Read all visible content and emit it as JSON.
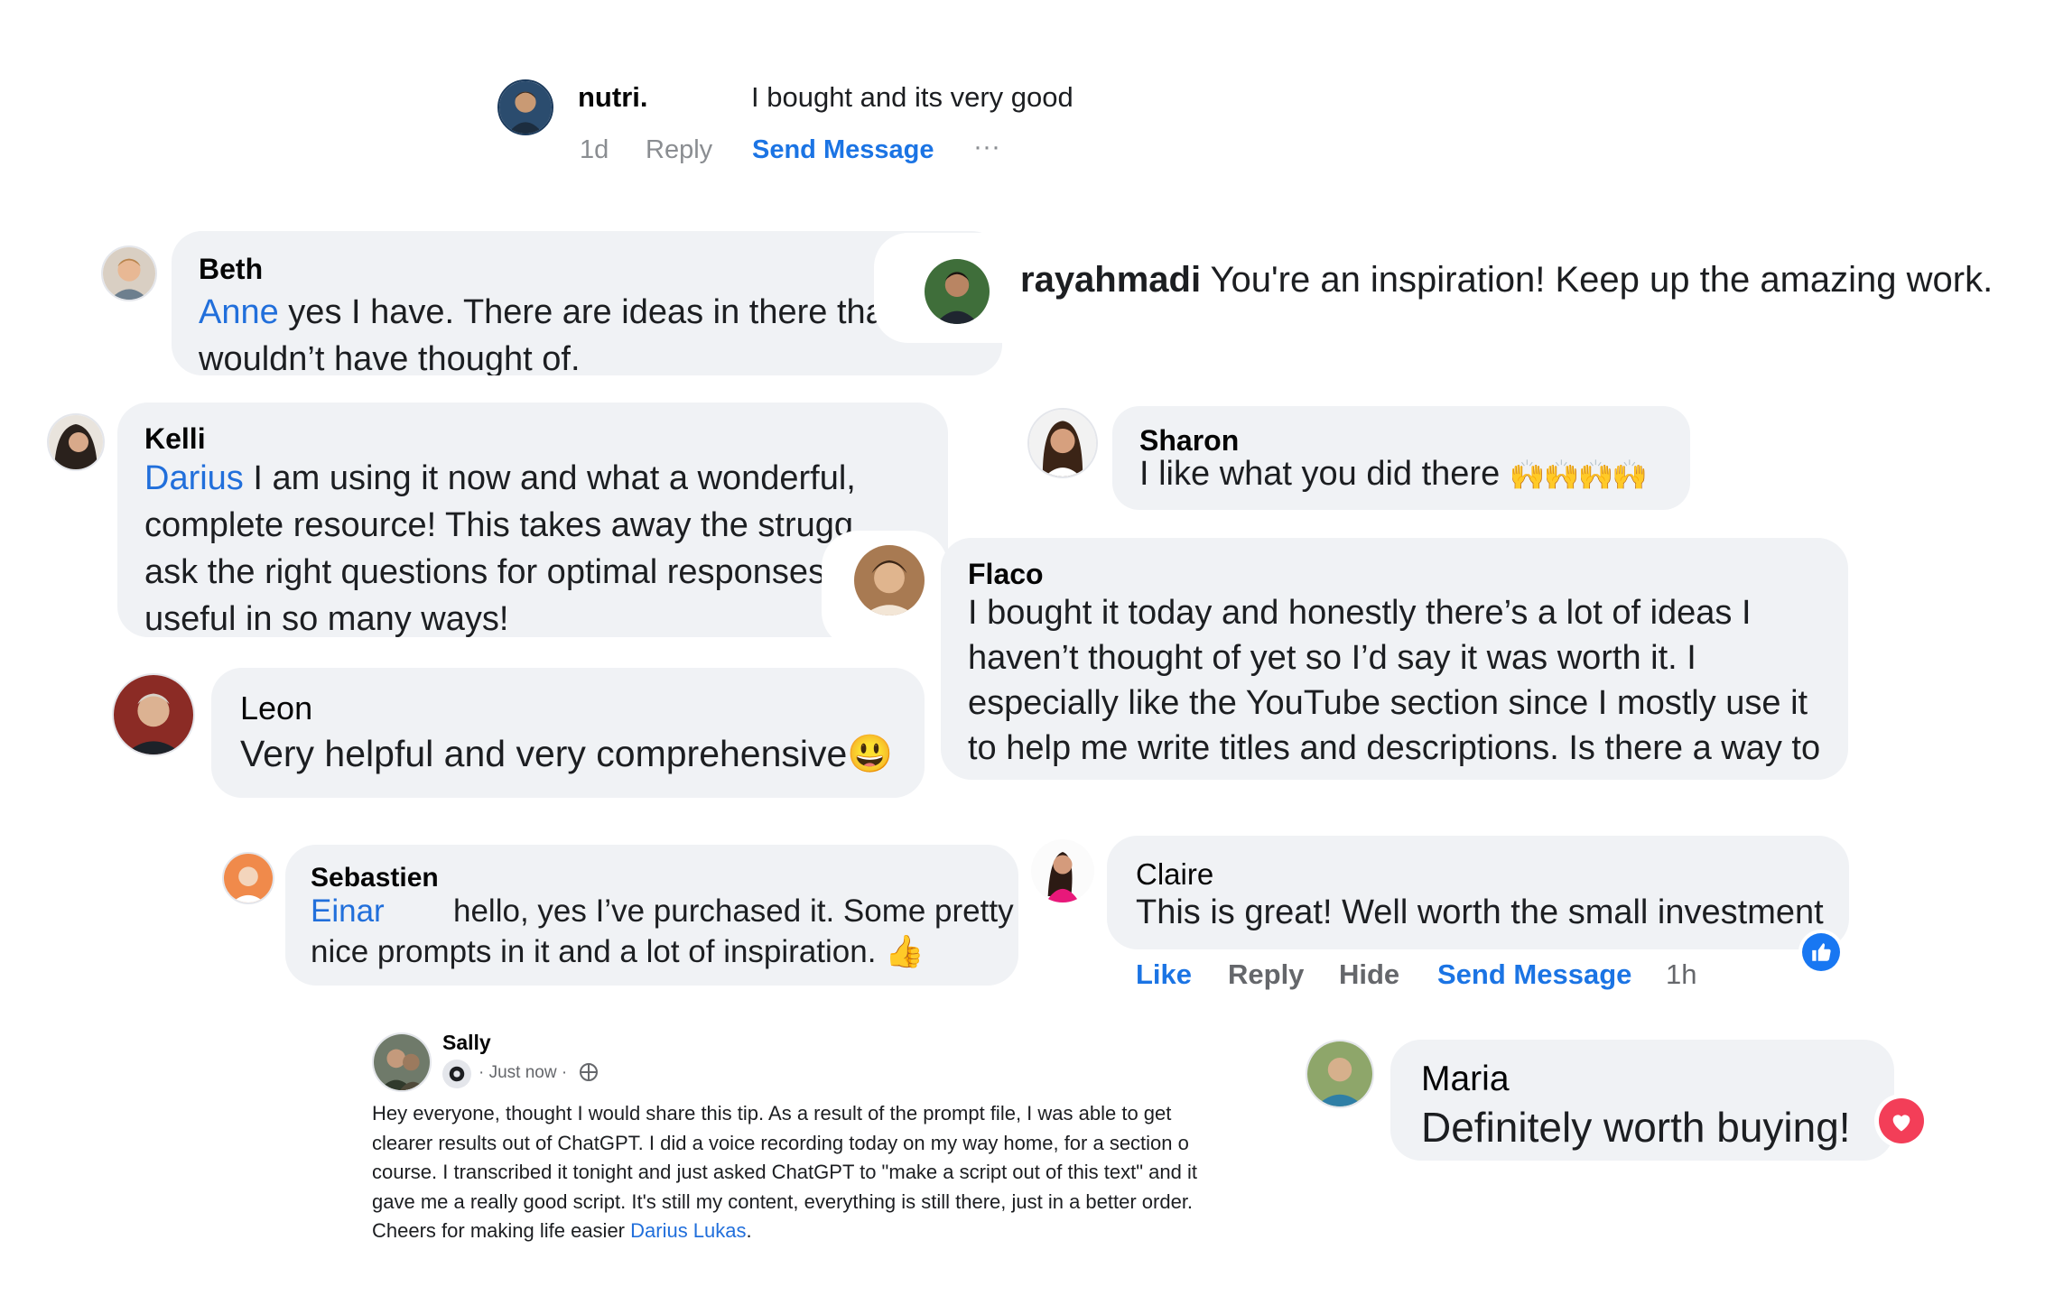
{
  "nutri": {
    "name": "nutri.",
    "text": "I bought and its very good",
    "time": "1d",
    "reply": "Reply",
    "send_message": "Send Message",
    "more": "···"
  },
  "beth": {
    "name": "Beth",
    "mention": "Anne",
    "text_line1": " yes I have. There are ideas in there tha",
    "text_line2": "wouldn’t have thought of."
  },
  "rayahmadi": {
    "name": "rayahmadi",
    "text": "You're an inspiration! Keep up the amazing work."
  },
  "kelli": {
    "name": "Kelli",
    "mention": "Darius",
    "text_line1": " I am using it now and what a wonderful,",
    "text_line2": "complete resource! This takes away the strugg",
    "text_line3": "ask the right questions for optimal responses",
    "text_line4": "useful in so many ways!"
  },
  "sharon": {
    "name": "Sharon",
    "text": "I like what you did there",
    "emoji": "🙌🙌🙌🙌"
  },
  "flaco": {
    "name": "Flaco",
    "text_line1": "I bought it today and honestly there’s a lot of ideas I",
    "text_line2": "haven’t thought of yet so I’d say it was worth it. I",
    "text_line3": "especially like the YouTube section since I mostly use it",
    "text_line4": "to help me write titles and descriptions. Is there a way to"
  },
  "leon": {
    "name": "Leon",
    "text": "Very helpful and very comprehensive",
    "emoji": "😃"
  },
  "sebastien": {
    "name": "Sebastien",
    "mention": "Einar",
    "text_line1": "hello, yes I’ve purchased it. Some pretty",
    "text_line2": "nice prompts in it and a lot of inspiration.",
    "emoji": "👍"
  },
  "claire": {
    "name": "Claire",
    "text": "This is great! Well worth the small investment",
    "like": "Like",
    "reply": "Reply",
    "hide": "Hide",
    "send_message": "Send Message",
    "time": "1h"
  },
  "sally": {
    "name": "Sally",
    "meta": "· Just now ·",
    "text_line1": "Hey everyone, thought I would share this tip.  As a result of the prompt file, I was able to get",
    "text_line2": "clearer results out of ChatGPT.  I did a voice recording today on my way home, for a section o",
    "text_line3": "course.  I transcribed it tonight and just asked ChatGPT to \"make a script out of this text\" and it",
    "text_line4": "gave me a really good script.  It's still my content, everything is still there, just in a better order.",
    "text_line5": "Cheers for making life easier ",
    "mention": "Darius Lukas",
    "text_end": "."
  },
  "maria": {
    "name": "Maria",
    "text": "Definitely worth buying!"
  },
  "colors": {
    "bubble": "#f0f2f5",
    "link": "#216fdb",
    "action_blue": "#1b74e4",
    "grey": "#65676b",
    "heart": "#f33e58",
    "like_blue": "#1877f2"
  }
}
